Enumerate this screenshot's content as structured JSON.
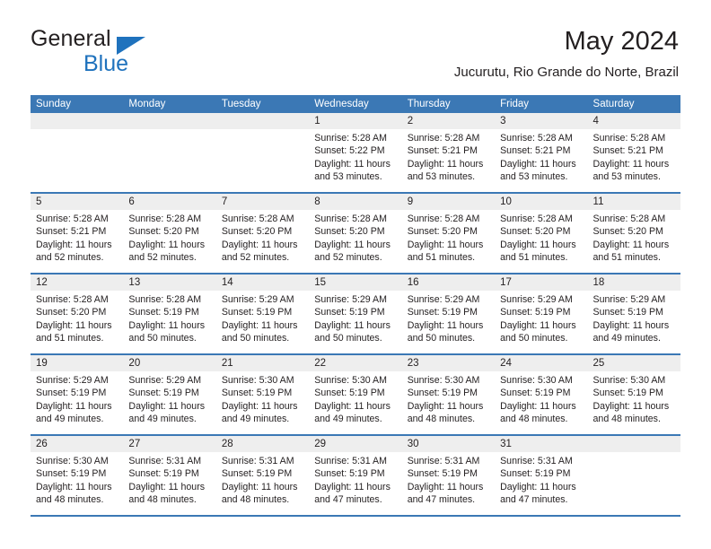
{
  "brand": {
    "name_part1": "General",
    "name_part2": "Blue",
    "accent_color": "#1f72bd"
  },
  "header": {
    "month_title": "May 2024",
    "location": "Jucurutu, Rio Grande do Norte, Brazil"
  },
  "calendar": {
    "header_color": "#3b78b5",
    "date_strip_color": "#eeeeee",
    "weekdays": [
      "Sunday",
      "Monday",
      "Tuesday",
      "Wednesday",
      "Thursday",
      "Friday",
      "Saturday"
    ],
    "weeks": [
      {
        "days": [
          {
            "num": "",
            "lines": []
          },
          {
            "num": "",
            "lines": []
          },
          {
            "num": "",
            "lines": []
          },
          {
            "num": "1",
            "lines": [
              "Sunrise: 5:28 AM",
              "Sunset: 5:22 PM",
              "Daylight: 11 hours",
              "and 53 minutes."
            ]
          },
          {
            "num": "2",
            "lines": [
              "Sunrise: 5:28 AM",
              "Sunset: 5:21 PM",
              "Daylight: 11 hours",
              "and 53 minutes."
            ]
          },
          {
            "num": "3",
            "lines": [
              "Sunrise: 5:28 AM",
              "Sunset: 5:21 PM",
              "Daylight: 11 hours",
              "and 53 minutes."
            ]
          },
          {
            "num": "4",
            "lines": [
              "Sunrise: 5:28 AM",
              "Sunset: 5:21 PM",
              "Daylight: 11 hours",
              "and 53 minutes."
            ]
          }
        ]
      },
      {
        "days": [
          {
            "num": "5",
            "lines": [
              "Sunrise: 5:28 AM",
              "Sunset: 5:21 PM",
              "Daylight: 11 hours",
              "and 52 minutes."
            ]
          },
          {
            "num": "6",
            "lines": [
              "Sunrise: 5:28 AM",
              "Sunset: 5:20 PM",
              "Daylight: 11 hours",
              "and 52 minutes."
            ]
          },
          {
            "num": "7",
            "lines": [
              "Sunrise: 5:28 AM",
              "Sunset: 5:20 PM",
              "Daylight: 11 hours",
              "and 52 minutes."
            ]
          },
          {
            "num": "8",
            "lines": [
              "Sunrise: 5:28 AM",
              "Sunset: 5:20 PM",
              "Daylight: 11 hours",
              "and 52 minutes."
            ]
          },
          {
            "num": "9",
            "lines": [
              "Sunrise: 5:28 AM",
              "Sunset: 5:20 PM",
              "Daylight: 11 hours",
              "and 51 minutes."
            ]
          },
          {
            "num": "10",
            "lines": [
              "Sunrise: 5:28 AM",
              "Sunset: 5:20 PM",
              "Daylight: 11 hours",
              "and 51 minutes."
            ]
          },
          {
            "num": "11",
            "lines": [
              "Sunrise: 5:28 AM",
              "Sunset: 5:20 PM",
              "Daylight: 11 hours",
              "and 51 minutes."
            ]
          }
        ]
      },
      {
        "days": [
          {
            "num": "12",
            "lines": [
              "Sunrise: 5:28 AM",
              "Sunset: 5:20 PM",
              "Daylight: 11 hours",
              "and 51 minutes."
            ]
          },
          {
            "num": "13",
            "lines": [
              "Sunrise: 5:28 AM",
              "Sunset: 5:19 PM",
              "Daylight: 11 hours",
              "and 50 minutes."
            ]
          },
          {
            "num": "14",
            "lines": [
              "Sunrise: 5:29 AM",
              "Sunset: 5:19 PM",
              "Daylight: 11 hours",
              "and 50 minutes."
            ]
          },
          {
            "num": "15",
            "lines": [
              "Sunrise: 5:29 AM",
              "Sunset: 5:19 PM",
              "Daylight: 11 hours",
              "and 50 minutes."
            ]
          },
          {
            "num": "16",
            "lines": [
              "Sunrise: 5:29 AM",
              "Sunset: 5:19 PM",
              "Daylight: 11 hours",
              "and 50 minutes."
            ]
          },
          {
            "num": "17",
            "lines": [
              "Sunrise: 5:29 AM",
              "Sunset: 5:19 PM",
              "Daylight: 11 hours",
              "and 50 minutes."
            ]
          },
          {
            "num": "18",
            "lines": [
              "Sunrise: 5:29 AM",
              "Sunset: 5:19 PM",
              "Daylight: 11 hours",
              "and 49 minutes."
            ]
          }
        ]
      },
      {
        "days": [
          {
            "num": "19",
            "lines": [
              "Sunrise: 5:29 AM",
              "Sunset: 5:19 PM",
              "Daylight: 11 hours",
              "and 49 minutes."
            ]
          },
          {
            "num": "20",
            "lines": [
              "Sunrise: 5:29 AM",
              "Sunset: 5:19 PM",
              "Daylight: 11 hours",
              "and 49 minutes."
            ]
          },
          {
            "num": "21",
            "lines": [
              "Sunrise: 5:30 AM",
              "Sunset: 5:19 PM",
              "Daylight: 11 hours",
              "and 49 minutes."
            ]
          },
          {
            "num": "22",
            "lines": [
              "Sunrise: 5:30 AM",
              "Sunset: 5:19 PM",
              "Daylight: 11 hours",
              "and 49 minutes."
            ]
          },
          {
            "num": "23",
            "lines": [
              "Sunrise: 5:30 AM",
              "Sunset: 5:19 PM",
              "Daylight: 11 hours",
              "and 48 minutes."
            ]
          },
          {
            "num": "24",
            "lines": [
              "Sunrise: 5:30 AM",
              "Sunset: 5:19 PM",
              "Daylight: 11 hours",
              "and 48 minutes."
            ]
          },
          {
            "num": "25",
            "lines": [
              "Sunrise: 5:30 AM",
              "Sunset: 5:19 PM",
              "Daylight: 11 hours",
              "and 48 minutes."
            ]
          }
        ]
      },
      {
        "days": [
          {
            "num": "26",
            "lines": [
              "Sunrise: 5:30 AM",
              "Sunset: 5:19 PM",
              "Daylight: 11 hours",
              "and 48 minutes."
            ]
          },
          {
            "num": "27",
            "lines": [
              "Sunrise: 5:31 AM",
              "Sunset: 5:19 PM",
              "Daylight: 11 hours",
              "and 48 minutes."
            ]
          },
          {
            "num": "28",
            "lines": [
              "Sunrise: 5:31 AM",
              "Sunset: 5:19 PM",
              "Daylight: 11 hours",
              "and 48 minutes."
            ]
          },
          {
            "num": "29",
            "lines": [
              "Sunrise: 5:31 AM",
              "Sunset: 5:19 PM",
              "Daylight: 11 hours",
              "and 47 minutes."
            ]
          },
          {
            "num": "30",
            "lines": [
              "Sunrise: 5:31 AM",
              "Sunset: 5:19 PM",
              "Daylight: 11 hours",
              "and 47 minutes."
            ]
          },
          {
            "num": "31",
            "lines": [
              "Sunrise: 5:31 AM",
              "Sunset: 5:19 PM",
              "Daylight: 11 hours",
              "and 47 minutes."
            ]
          },
          {
            "num": "",
            "lines": []
          }
        ]
      }
    ]
  }
}
